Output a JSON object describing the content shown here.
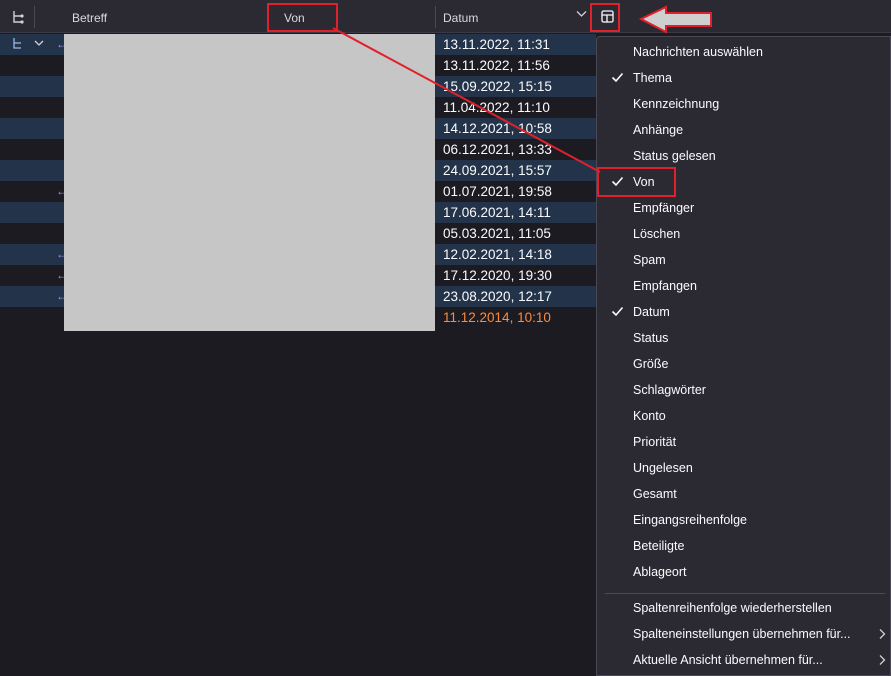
{
  "columns": {
    "thread_icon": "thread-tree-icon",
    "betreff": "Betreff",
    "von": "Von",
    "datum": "Datum",
    "sort_icon": "chevron-down-icon",
    "picker_icon": "column-picker-icon"
  },
  "rows": [
    {
      "date": "13.11.2022, 11:31",
      "highlight": true
    },
    {
      "date": "13.11.2022, 11:56",
      "highlight": false
    },
    {
      "date": "15.09.2022, 15:15",
      "highlight": true
    },
    {
      "date": "11.04.2022, 11:10",
      "highlight": false
    },
    {
      "date": "14.12.2021, 10:58",
      "highlight": true
    },
    {
      "date": "06.12.2021, 13:33",
      "highlight": false
    },
    {
      "date": "24.09.2021, 15:57",
      "highlight": true
    },
    {
      "date": "01.07.2021, 19:58",
      "highlight": false
    },
    {
      "date": "17.06.2021, 14:11",
      "highlight": true
    },
    {
      "date": "05.03.2021, 11:05",
      "highlight": false
    },
    {
      "date": "12.02.2021, 14:18",
      "highlight": true
    },
    {
      "date": "17.12.2020, 19:30",
      "highlight": false
    },
    {
      "date": "23.08.2020, 12:17",
      "highlight": true
    },
    {
      "date": "11.12.2014, 10:10",
      "highlight": false,
      "color": "#ff8a3c"
    }
  ],
  "menu": {
    "items": [
      {
        "label": "Nachrichten auswählen",
        "checked": false
      },
      {
        "label": "Thema",
        "checked": true
      },
      {
        "label": "Kennzeichnung",
        "checked": false
      },
      {
        "label": "Anhänge",
        "checked": false
      },
      {
        "label": "Status gelesen",
        "checked": false
      },
      {
        "label": "Von",
        "checked": true
      },
      {
        "label": "Empfänger",
        "checked": false
      },
      {
        "label": "Löschen",
        "checked": false
      },
      {
        "label": "Spam",
        "checked": false
      },
      {
        "label": "Empfangen",
        "checked": false
      },
      {
        "label": "Datum",
        "checked": true
      },
      {
        "label": "Status",
        "checked": false
      },
      {
        "label": "Größe",
        "checked": false
      },
      {
        "label": "Schlagwörter",
        "checked": false
      },
      {
        "label": "Konto",
        "checked": false
      },
      {
        "label": "Priorität",
        "checked": false
      },
      {
        "label": "Ungelesen",
        "checked": false
      },
      {
        "label": "Gesamt",
        "checked": false
      },
      {
        "label": "Eingangsreihenfolge",
        "checked": false
      },
      {
        "label": "Beteiligte",
        "checked": false
      },
      {
        "label": "Ablageort",
        "checked": false
      }
    ],
    "actions": [
      {
        "label": "Spaltenreihenfolge wiederherstellen",
        "submenu": false
      },
      {
        "label": "Spalteneinstellungen übernehmen für...",
        "submenu": true
      },
      {
        "label": "Aktuelle Ansicht übernehmen für...",
        "submenu": true
      }
    ]
  },
  "colors": {
    "accent_red": "#e0212c",
    "row_highlight": "#23344a",
    "date_old": "#ff8a3c"
  }
}
